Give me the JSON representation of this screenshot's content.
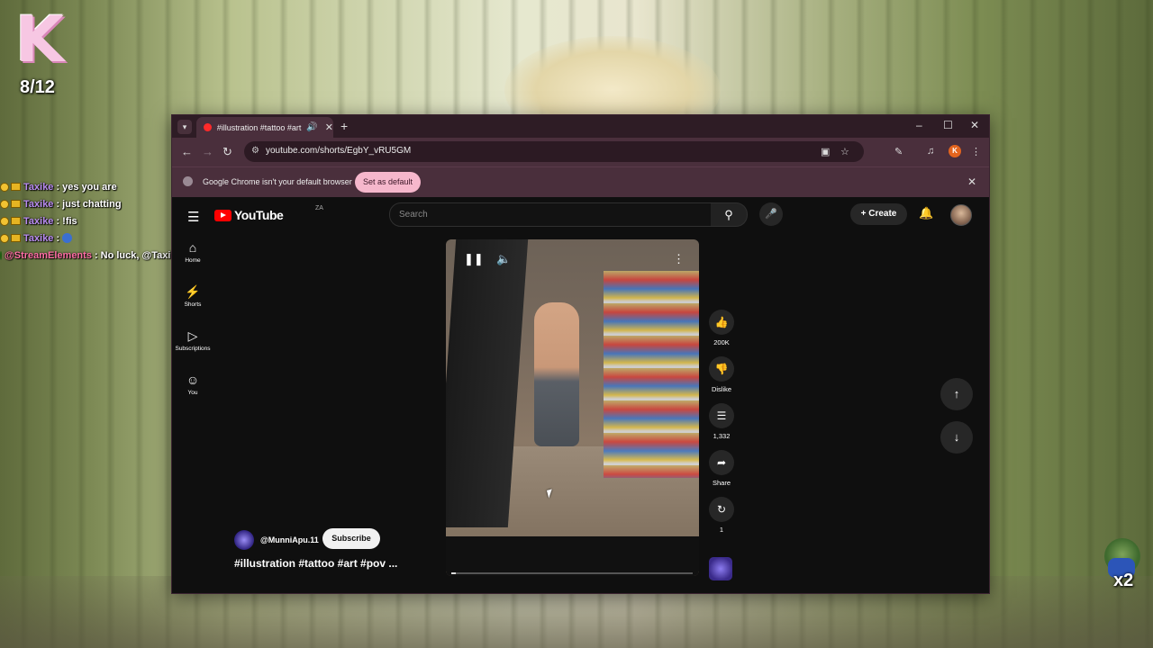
{
  "overlay": {
    "logo_letter": "K",
    "counter": "8/12",
    "x2": "x2"
  },
  "chat": [
    {
      "user": "Taxike",
      "message": ": yes you are"
    },
    {
      "user": "Taxike",
      "message": ": just chatting"
    },
    {
      "user": "Taxike",
      "message": ": !fis"
    },
    {
      "user": "Taxike",
      "message": ":"
    },
    {
      "user": "@StreamElements",
      "message": ": No luck, @Taxike"
    }
  ],
  "browser": {
    "tab_title": "#illustration #tattoo #art #pov",
    "url": "youtube.com/shorts/EgbY_vRU5GM",
    "infobar_text": "Google Chrome isn't your default browser",
    "infobar_button": "Set as default",
    "profile_initial": "K"
  },
  "youtube": {
    "logo_text": "YouTube",
    "region": "ZA",
    "search_placeholder": "Search",
    "create_label": "Create",
    "sidebar": [
      {
        "label": "Home",
        "icon": "home-icon"
      },
      {
        "label": "Shorts",
        "icon": "shorts-icon"
      },
      {
        "label": "Subscriptions",
        "icon": "subscriptions-icon"
      },
      {
        "label": "You",
        "icon": "you-icon"
      }
    ],
    "actions": {
      "likes": "200K",
      "dislike": "Dislike",
      "comments": "1,332",
      "share": "Share",
      "remix": "1"
    },
    "creator": {
      "handle": "@MunniApu.11",
      "subscribe_label": "Subscribe",
      "title": "#illustration #tattoo #art #pov ..."
    },
    "video_progress": 0.02
  }
}
